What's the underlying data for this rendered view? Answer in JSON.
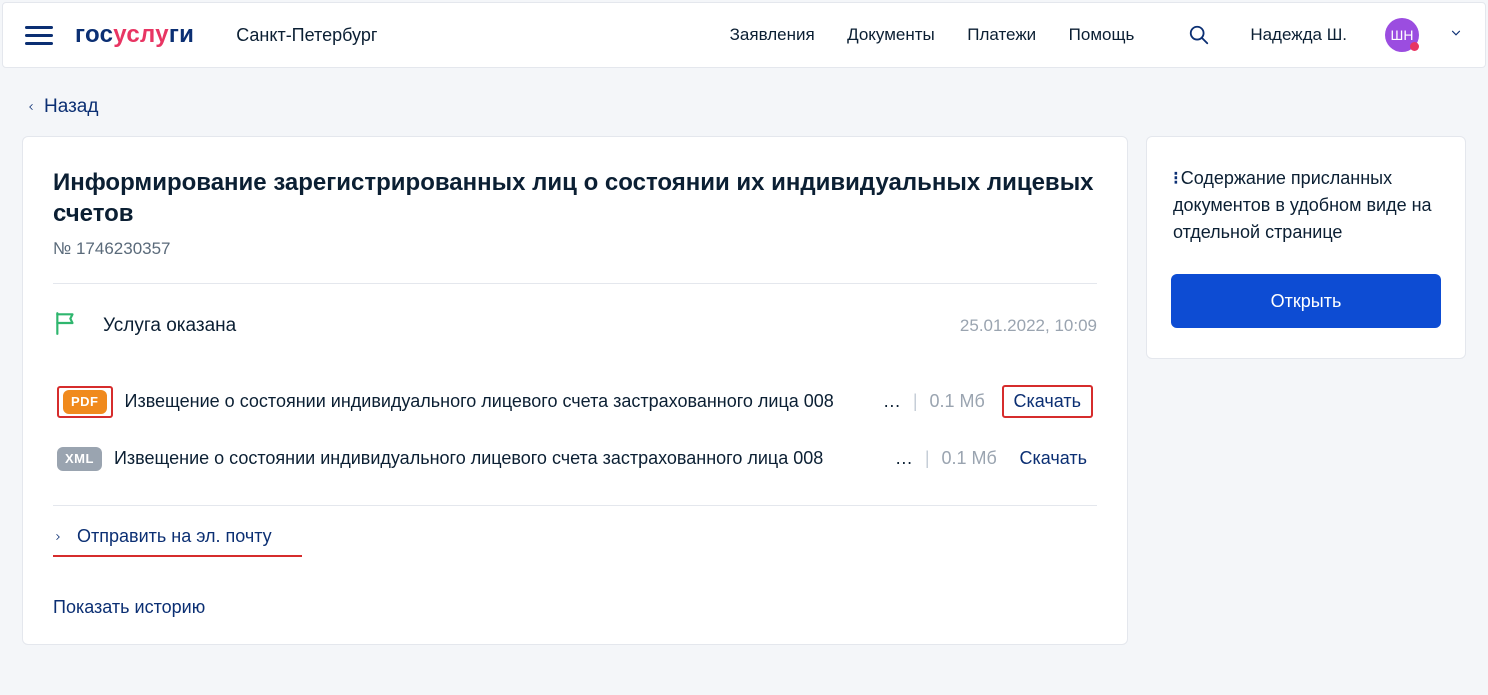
{
  "header": {
    "logo_gos": "гос",
    "logo_usl": "услу",
    "logo_ugi": "ги",
    "location": "Санкт-Петербург",
    "nav": {
      "applications": "Заявления",
      "documents": "Документы",
      "payments": "Платежи",
      "help": "Помощь"
    },
    "user_name": "Надежда Ш.",
    "avatar_initials": "ШН"
  },
  "back_label": "Назад",
  "main": {
    "title": "Информирование зарегистрированных лиц о состоянии их индивидуальных лицевых счетов",
    "req_no": "№ 1746230357",
    "status_text": "Услуга оказана",
    "status_date": "25.01.2022, 10:09",
    "files": [
      {
        "badge": "PDF",
        "badge_class": "badge-pdf",
        "name": "Извещение о состоянии индивидуального лицевого счета застрахованного лица 008",
        "size": "0.1 Мб",
        "download": "Скачать",
        "highlighted": true
      },
      {
        "badge": "XML",
        "badge_class": "badge-xml",
        "name": "Извещение о состоянии индивидуального лицевого счета застрахованного лица 008",
        "size": "0.1 Мб",
        "download": "Скачать",
        "highlighted": false
      }
    ],
    "send_email": "Отправить на эл. почту",
    "show_history": "Показать историю"
  },
  "side": {
    "text": "Содержание присланных документов в удобном виде на отдельной странице",
    "open_btn": "Открыть"
  }
}
